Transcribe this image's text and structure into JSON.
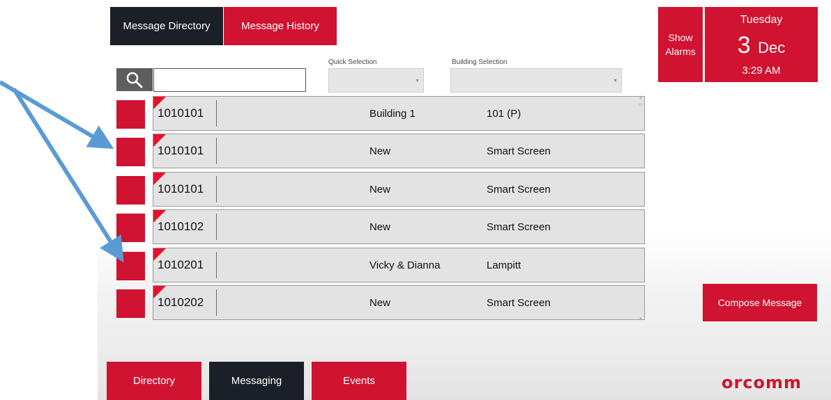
{
  "tabs": {
    "directory": "Message Directory",
    "history": "Message History"
  },
  "search": {
    "placeholder": "",
    "value": ""
  },
  "quick_selection": {
    "label": "Quick Selection",
    "value": ""
  },
  "building_selection": {
    "label": "Building Selection",
    "value": ""
  },
  "rows": [
    {
      "code": "1010101",
      "first": "Building 1",
      "second": "101 (P)"
    },
    {
      "code": "1010101",
      "first": "New",
      "second": "Smart Screen"
    },
    {
      "code": "1010101",
      "first": "New",
      "second": "Smart Screen"
    },
    {
      "code": "1010102",
      "first": "New",
      "second": "Smart Screen"
    },
    {
      "code": "1010201",
      "first": "Vicky & Dianna",
      "second": "Lampitt"
    },
    {
      "code": "1010202",
      "first": "New",
      "second": "Smart Screen"
    }
  ],
  "alarms": {
    "line1": "Show",
    "line2": "Alarms"
  },
  "date": {
    "weekday": "Tuesday",
    "day": "3",
    "month": "Dec",
    "time": "3:29 AM"
  },
  "compose_label": "Compose Message",
  "bottom_tabs": {
    "directory": "Directory",
    "messaging": "Messaging",
    "events": "Events"
  },
  "logo": "orcomm",
  "colors": {
    "accent_red": "#cf1330",
    "dark": "#1b1f27",
    "annotation_arrow": "#5b9bd5"
  },
  "icons": {
    "search": "magnifier-icon"
  }
}
